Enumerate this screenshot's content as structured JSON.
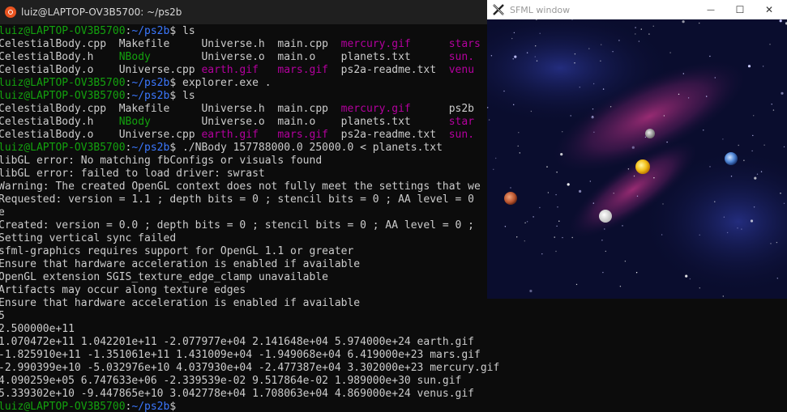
{
  "terminal": {
    "title": "luiz@LAPTOP-OV3B5700: ~/ps2b",
    "lines": [
      [
        [
          "luiz@LAPTOP-OV3B5700",
          "green"
        ],
        [
          ":",
          "white"
        ],
        [
          "~/ps2b",
          "blue"
        ],
        [
          "$ ls",
          "white"
        ]
      ],
      [
        [
          "CelestialBody.cpp  Makefile     Universe.h  main.cpp  ",
          "white"
        ],
        [
          "mercury.gif",
          "mag"
        ],
        [
          "      ",
          "white"
        ],
        [
          "stars",
          "mag"
        ]
      ],
      [
        [
          "CelestialBody.h    ",
          "white"
        ],
        [
          "NBody",
          "green"
        ],
        [
          "        Universe.o  main.o    planets.txt      ",
          "white"
        ],
        [
          "sun.",
          "mag"
        ]
      ],
      [
        [
          "CelestialBody.o    Universe.cpp ",
          "white"
        ],
        [
          "earth.gif",
          "mag"
        ],
        [
          "   ",
          "white"
        ],
        [
          "mars.gif",
          "mag"
        ],
        [
          "  ps2a-readme.txt  ",
          "white"
        ],
        [
          "venu",
          "mag"
        ]
      ],
      [
        [
          "luiz@LAPTOP-OV3B5700",
          "green"
        ],
        [
          ":",
          "white"
        ],
        [
          "~/ps2b",
          "blue"
        ],
        [
          "$ explorer.exe .",
          "white"
        ]
      ],
      [
        [
          "luiz@LAPTOP-OV3B5700",
          "green"
        ],
        [
          ":",
          "white"
        ],
        [
          "~/ps2b",
          "blue"
        ],
        [
          "$ ls",
          "white"
        ]
      ],
      [
        [
          "CelestialBody.cpp  Makefile     Universe.h  main.cpp  ",
          "white"
        ],
        [
          "mercury.gif",
          "mag"
        ],
        [
          "      ps2b",
          "white"
        ]
      ],
      [
        [
          "CelestialBody.h    ",
          "white"
        ],
        [
          "NBody",
          "green"
        ],
        [
          "        Universe.o  main.o    planets.txt      ",
          "white"
        ],
        [
          "star",
          "mag"
        ]
      ],
      [
        [
          "CelestialBody.o    Universe.cpp ",
          "white"
        ],
        [
          "earth.gif",
          "mag"
        ],
        [
          "   ",
          "white"
        ],
        [
          "mars.gif",
          "mag"
        ],
        [
          "  ps2a-readme.txt  ",
          "white"
        ],
        [
          "sun.",
          "mag"
        ]
      ],
      [
        [
          "luiz@LAPTOP-OV3B5700",
          "green"
        ],
        [
          ":",
          "white"
        ],
        [
          "~/ps2b",
          "blue"
        ],
        [
          "$ ./NBody 157788000.0 25000.0 < planets.txt",
          "white"
        ]
      ],
      [
        [
          "libGL error: No matching fbConfigs or visuals found",
          "white"
        ]
      ],
      [
        [
          "libGL error: failed to load driver: swrast",
          "white"
        ]
      ],
      [
        [
          "Warning: The created OpenGL context does not fully meet the settings that we",
          "white"
        ]
      ],
      [
        [
          "Requested: version = 1.1 ; depth bits = 0 ; stencil bits = 0 ; AA level = 0",
          "white"
        ]
      ],
      [
        [
          "e",
          "white"
        ]
      ],
      [
        [
          "Created: version = 0.0 ; depth bits = 0 ; stencil bits = 0 ; AA level = 0 ;",
          "white"
        ]
      ],
      [
        [
          "Setting vertical sync failed",
          "white"
        ]
      ],
      [
        [
          "sfml-graphics requires support for OpenGL 1.1 or greater",
          "white"
        ]
      ],
      [
        [
          "Ensure that hardware acceleration is enabled if available",
          "white"
        ]
      ],
      [
        [
          "OpenGL extension SGIS_texture_edge_clamp unavailable",
          "white"
        ]
      ],
      [
        [
          "Artifacts may occur along texture edges",
          "white"
        ]
      ],
      [
        [
          "Ensure that hardware acceleration is enabled if available",
          "white"
        ]
      ],
      [
        [
          "5",
          "white"
        ]
      ],
      [
        [
          "2.500000e+11",
          "white"
        ]
      ],
      [
        [
          "1.070472e+11 1.042201e+11 -2.077977e+04 2.141648e+04 5.974000e+24 earth.gif",
          "white"
        ]
      ],
      [
        [
          "-1.825910e+11 -1.351061e+11 1.431009e+04 -1.949068e+04 6.419000e+23 mars.gif",
          "white"
        ]
      ],
      [
        [
          "-2.990399e+10 -5.032976e+10 4.037930e+04 -2.477387e+04 3.302000e+23 mercury.gif",
          "white"
        ]
      ],
      [
        [
          "4.090259e+05 6.747633e+06 -2.339539e-02 9.517864e-02 1.989000e+30 sun.gif",
          "white"
        ]
      ],
      [
        [
          "5.339302e+10 -9.447865e+10 3.042778e+04 1.708063e+04 4.869000e+24 venus.gif",
          "white"
        ]
      ],
      [
        [
          "luiz@LAPTOP-OV3B5700",
          "green"
        ],
        [
          ":",
          "white"
        ],
        [
          "~/ps2b",
          "blue"
        ],
        [
          "$",
          "white"
        ]
      ]
    ]
  },
  "sfml_window": {
    "title": "SFML window",
    "minimize_glyph": "—",
    "maximize_glyph": "☐",
    "close_glyph": "✕"
  },
  "colors": {
    "terminal_bg": "#0c0c0c",
    "prompt_green": "#13a10e",
    "path_blue": "#3b78ff",
    "file_magenta": "#b4009e",
    "text": "#cccccc"
  }
}
